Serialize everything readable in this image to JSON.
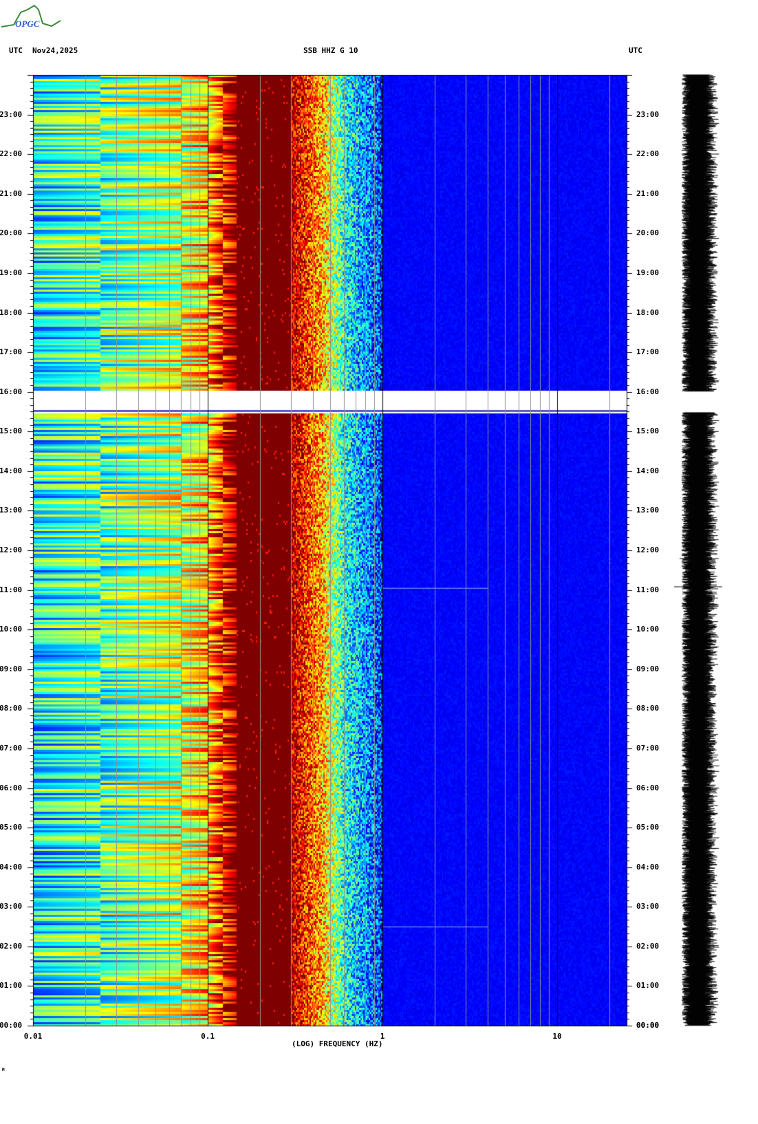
{
  "logo": {
    "text": "OPGC"
  },
  "header": {
    "left_tz": "UTC",
    "date": "Nov24,2025",
    "station": "SSB HHZ G 10",
    "right_tz": "UTC"
  },
  "chart_data": {
    "type": "heatmap",
    "title": "SSB HHZ G 10",
    "xlabel": "(LOG) FREQUENCY (HZ)",
    "xscale": "log",
    "xlim": [
      0.01,
      25
    ],
    "xticks": [
      {
        "value": 0.01,
        "label": "0.01"
      },
      {
        "value": 0.1,
        "label": "0.1"
      },
      {
        "value": 1,
        "label": "1"
      },
      {
        "value": 10,
        "label": "10"
      }
    ],
    "ylabel": "UTC",
    "ylim_hours": [
      0,
      24
    ],
    "yticks": [
      "00:00",
      "01:00",
      "02:00",
      "03:00",
      "04:00",
      "05:00",
      "06:00",
      "07:00",
      "08:00",
      "09:00",
      "10:00",
      "11:00",
      "12:00",
      "13:00",
      "14:00",
      "15:00",
      "16:00",
      "17:00",
      "18:00",
      "19:00",
      "20:00",
      "21:00",
      "22:00",
      "23:00"
    ],
    "data_gap_hours": [
      15.5,
      16.0
    ],
    "colormap": "jet",
    "spectral_profile": [
      {
        "f": 0.01,
        "level": 0.38
      },
      {
        "f": 0.024,
        "level": 0.45
      },
      {
        "f": 0.07,
        "level": 0.58
      },
      {
        "f": 0.1,
        "level": 0.68
      },
      {
        "f": 0.12,
        "level": 0.85
      },
      {
        "f": 0.145,
        "level": 1.0
      },
      {
        "f": 0.3,
        "level": 0.95
      },
      {
        "f": 0.45,
        "level": 0.7
      },
      {
        "f": 0.6,
        "level": 0.4
      },
      {
        "f": 0.95,
        "level": 0.2
      },
      {
        "f": 1.0,
        "level": 0.12
      },
      {
        "f": 25,
        "level": 0.1
      }
    ],
    "events_hours": [
      2.5,
      11.05
    ],
    "grid": true
  },
  "footer": {
    "mark": "M"
  }
}
